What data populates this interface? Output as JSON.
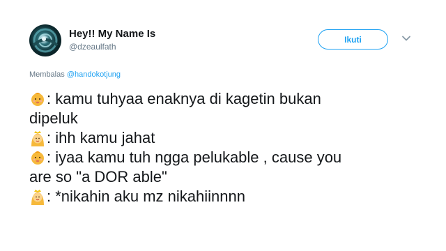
{
  "user": {
    "display_name": "Hey!! My Name Is",
    "handle": "@dzeaulfath"
  },
  "actions": {
    "follow_label": "Ikuti",
    "menu_icon": "chevron-down-icon"
  },
  "reply": {
    "prefix": "Membalas",
    "mention": "@handokotjung"
  },
  "tweet": {
    "lines": [
      {
        "emoji": "baby-face-emoji",
        "text": ": kamu tuhyaa enaknya di kagetin bukan"
      },
      {
        "emoji": "",
        "text": "dipeluk"
      },
      {
        "emoji": "princess-emoji",
        "text": ": ihh kamu jahat"
      },
      {
        "emoji": "baby-face-emoji",
        "text": ": iyaa kamu tuh ngga pelukable , cause you"
      },
      {
        "emoji": "",
        "text": "are so \"a DOR able\""
      },
      {
        "emoji": "princess-emoji",
        "text": ": *nikahin aku mz nikahiinnnn"
      }
    ]
  },
  "colors": {
    "accent": "#1da1f2",
    "text": "#14171a",
    "muted": "#657786"
  }
}
